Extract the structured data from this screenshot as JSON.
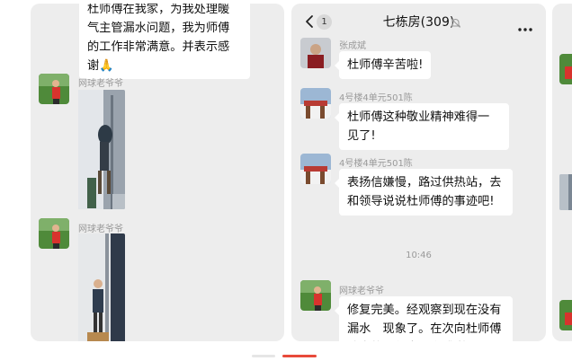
{
  "left_panel": {
    "top_message_lines": [
      "杜师傅在我家，为我处理暖",
      "气主管漏水问题，我为师傅",
      "的工作非常满意。并表示感",
      "谢🙏"
    ],
    "messages": [
      {
        "sender": "网球老爷爷"
      },
      {
        "sender": "网球老爷爷"
      }
    ]
  },
  "chat": {
    "unread_count": "1",
    "title": "七栋房(309)",
    "messages": [
      {
        "sender": "张成斌",
        "text": "杜师傅辛苦啦!"
      },
      {
        "sender": "4号楼4单元501陈",
        "text": "杜师傅这种敬业精神难得一见了!"
      },
      {
        "sender": "4号楼4单元501陈",
        "text": "表扬信嫌慢，路过供热站，去和领导说说杜师傅的事迹吧!"
      },
      {
        "sender": "网球老爷爷",
        "text": "修复完美。经观察到现在没有漏水　现象了。在次向杜师傅认真的工作表示竟感谢"
      }
    ],
    "timestamp": "10:46"
  },
  "colors": {
    "panel_bg": "#ededed",
    "bubble_bg": "#ffffff",
    "accent_indicator": "#e84a3a"
  }
}
